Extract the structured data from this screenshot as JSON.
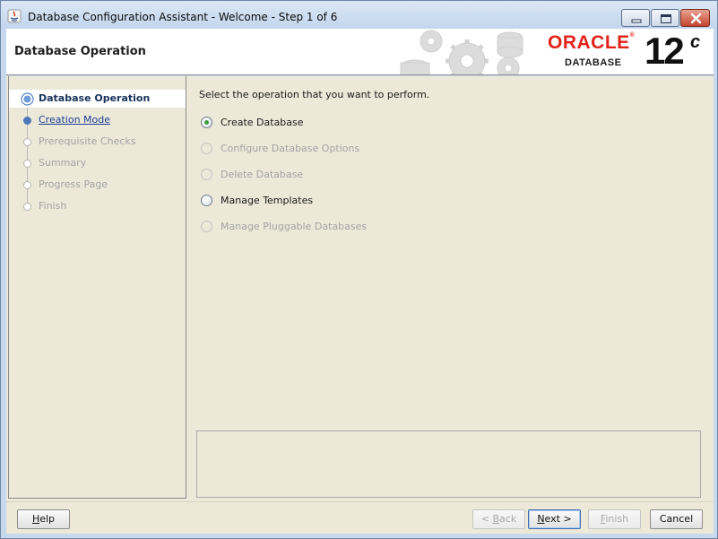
{
  "window": {
    "title": "Database Configuration Assistant - Welcome - Step 1 of 6",
    "controls": [
      "minimize-icon",
      "maximize-icon",
      "close-icon"
    ]
  },
  "header": {
    "page_title": "Database Operation",
    "brand": "ORACLE",
    "brand_mark": "®",
    "product": "DATABASE",
    "version": "12",
    "version_suffix": "c"
  },
  "sidebar": {
    "steps": [
      {
        "label": "Database Operation",
        "state": "current"
      },
      {
        "label": "Creation Mode",
        "state": "link"
      },
      {
        "label": "Prerequisite Checks",
        "state": "disabled"
      },
      {
        "label": "Summary",
        "state": "disabled"
      },
      {
        "label": "Progress Page",
        "state": "disabled"
      },
      {
        "label": "Finish",
        "state": "disabled"
      }
    ]
  },
  "main": {
    "prompt": "Select the operation that you want to perform.",
    "options": [
      {
        "label": "Create Database",
        "selected": true,
        "enabled": true
      },
      {
        "label": "Configure Database Options",
        "selected": false,
        "enabled": false
      },
      {
        "label": "Delete Database",
        "selected": false,
        "enabled": false
      },
      {
        "label": "Manage Templates",
        "selected": false,
        "enabled": true
      },
      {
        "label": "Manage Pluggable Databases",
        "selected": false,
        "enabled": false
      }
    ],
    "message": ""
  },
  "footer": {
    "help": {
      "mnemonic": "H",
      "rest": "elp",
      "enabled": true
    },
    "back": {
      "prefix": "< ",
      "mnemonic": "B",
      "rest": "ack",
      "enabled": false
    },
    "next": {
      "mnemonic": "N",
      "rest": "ext >",
      "enabled": true
    },
    "finish": {
      "mnemonic": "F",
      "rest": "inish",
      "enabled": false
    },
    "cancel": {
      "label": "Cancel",
      "enabled": true
    }
  },
  "colors": {
    "accent_red": "#e2231a",
    "selected_radio": "#3d9a3d",
    "step_active": "#17325a",
    "step_link": "#1c3f94"
  }
}
